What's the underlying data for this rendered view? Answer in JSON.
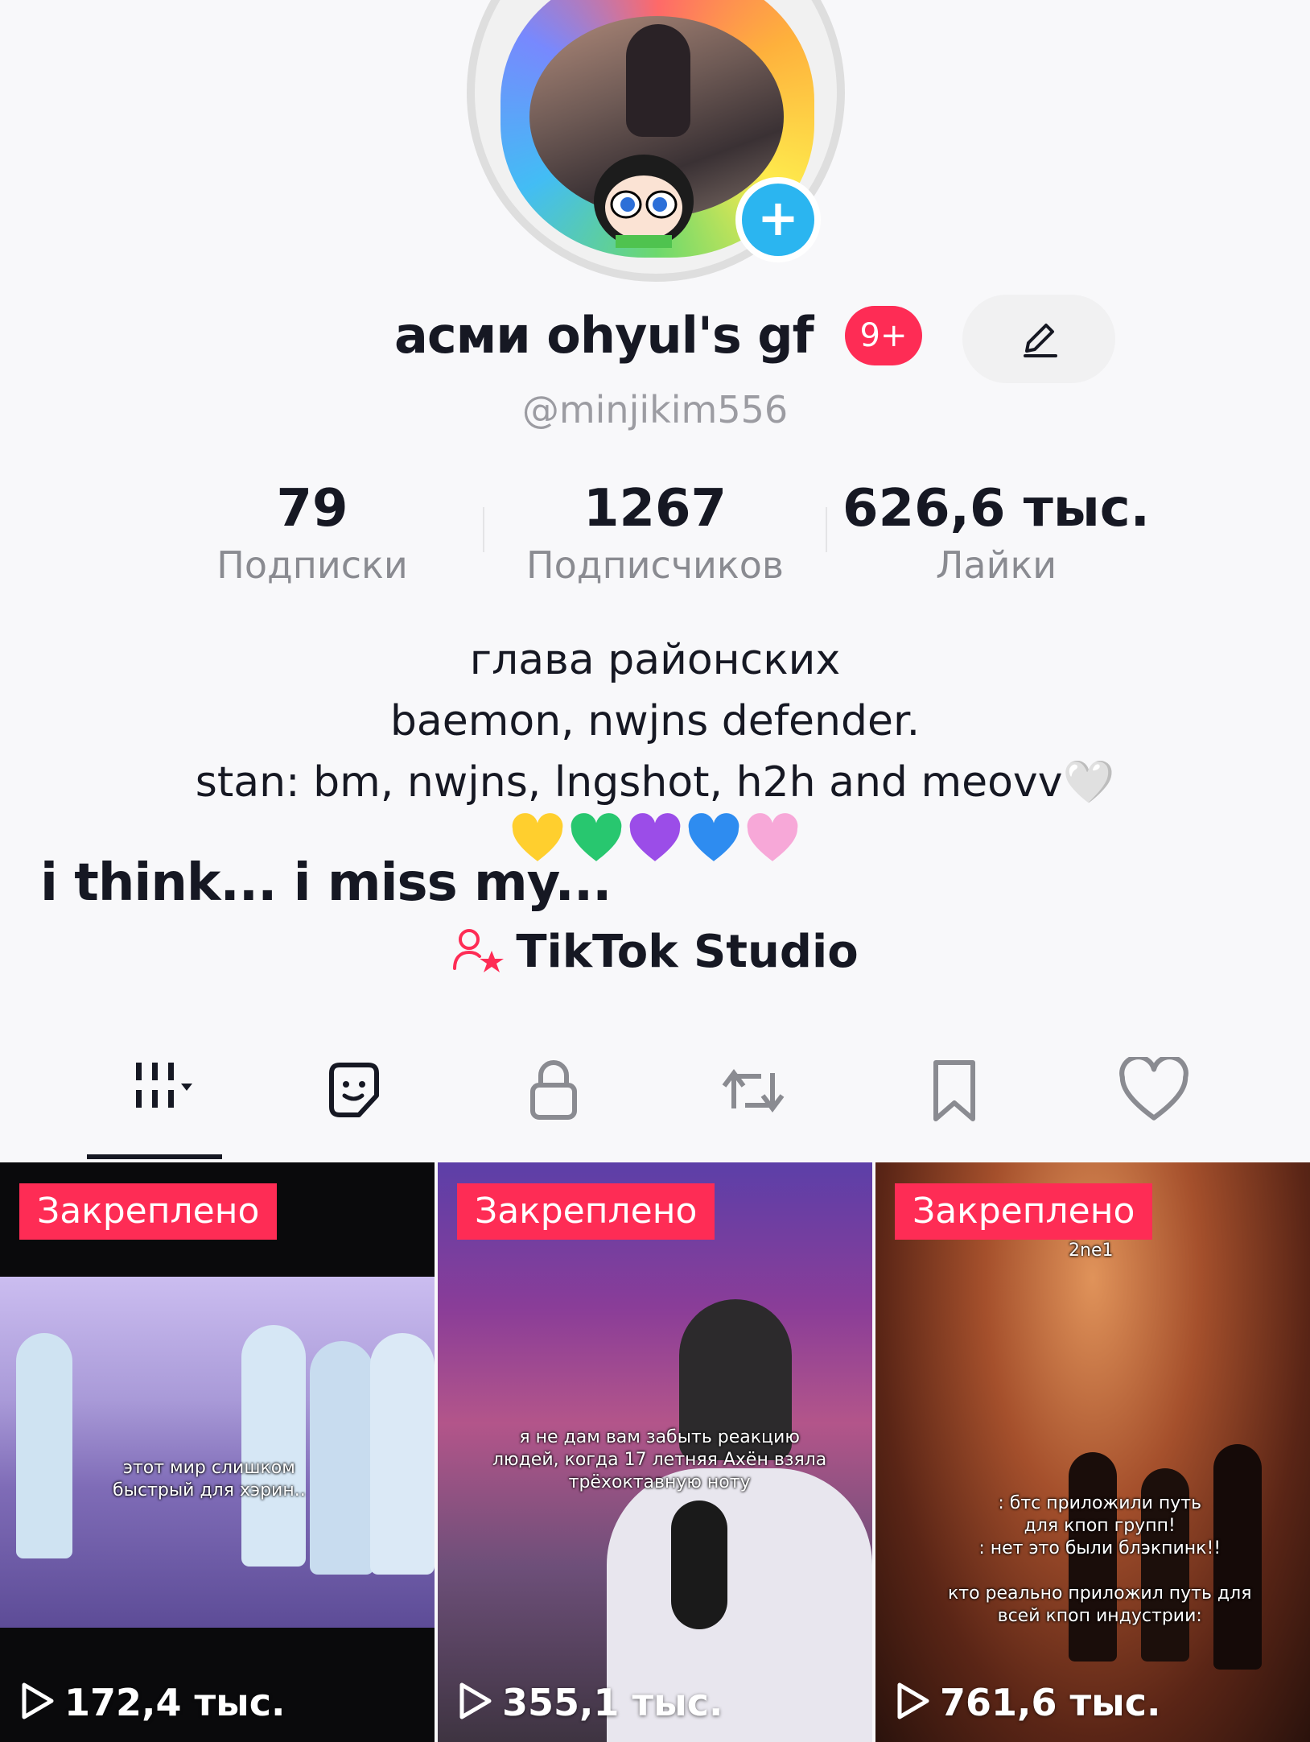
{
  "profile": {
    "display_name": "асми ohyul's gf",
    "badge": "9+",
    "username": "@minjikim556"
  },
  "stats": {
    "following": {
      "value": "79",
      "label": "Подписки"
    },
    "followers": {
      "value": "1267",
      "label": "Подписчиков"
    },
    "likes": {
      "value": "626,6 тыс.",
      "label": "Лайки"
    }
  },
  "bio": {
    "line1": "глава районских",
    "line2": "baemon, nwjns defender.",
    "line3": "stan: bm, nwjns, lngshot, h2h and meovv🤍",
    "hearts": [
      "yellow-heart",
      "green-heart",
      "purple-heart",
      "blue-heart",
      "pink-heart"
    ]
  },
  "overlay_caption": "i think... i miss my...",
  "studio": {
    "label": "TikTok Studio"
  },
  "tabs": [
    "videos-grid-icon",
    "stickers-icon",
    "lock-icon",
    "repost-icon",
    "bookmark-icon",
    "heart-icon"
  ],
  "videos": [
    {
      "pinned_label": "Закреплено",
      "views": "172,4 тыс.",
      "caption": [
        "этот мир слишком",
        "быстрый для хэрин.."
      ]
    },
    {
      "pinned_label": "Закреплено",
      "views": "355,1 тыс.",
      "caption": [
        "я не дам вам забыть реакцию",
        "людей, когда 17 летняя Ахён взяла",
        "трёхоктавную ноту"
      ]
    },
    {
      "pinned_label": "Закреплено",
      "views": "761,6 тыс.",
      "caption": [
        ": бтс приложили путь",
        "для кпоп групп!",
        ": нет это были блэкпинк!!",
        "",
        "кто реально приложил путь для",
        "всей кпоп индустрии:"
      ],
      "top_text": "2ne1"
    }
  ],
  "colors": {
    "accent": "#fe2c55",
    "plus": "#2bb5f0",
    "text": "#161823",
    "muted": "#8a8b91"
  }
}
